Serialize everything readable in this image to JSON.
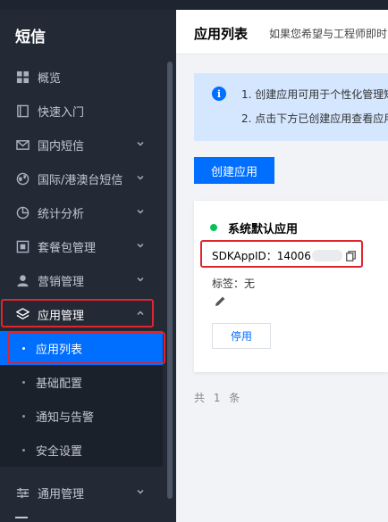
{
  "sidebar": {
    "title": "短信",
    "items": [
      {
        "label": "概览",
        "icon": "grid-icon",
        "chevron": false
      },
      {
        "label": "快速入门",
        "icon": "book-icon",
        "chevron": false
      },
      {
        "label": "国内短信",
        "icon": "mail-icon",
        "chevron": true
      },
      {
        "label": "国际/港澳台短信",
        "icon": "globe-icon",
        "chevron": true
      },
      {
        "label": "统计分析",
        "icon": "pie-chart-icon",
        "chevron": true
      },
      {
        "label": "套餐包管理",
        "icon": "package-icon",
        "chevron": true
      },
      {
        "label": "营销管理",
        "icon": "user-icon",
        "chevron": true
      },
      {
        "label": "应用管理",
        "icon": "layers-icon",
        "chevron": true,
        "expanded": true
      },
      {
        "label": "通用管理",
        "icon": "sliders-icon",
        "chevron": true
      }
    ],
    "subitems": [
      {
        "label": "应用列表",
        "active": true
      },
      {
        "label": "基础配置",
        "active": false
      },
      {
        "label": "通知与告警",
        "active": false
      },
      {
        "label": "安全设置",
        "active": false
      }
    ]
  },
  "header": {
    "title": "应用列表",
    "note": "如果您希望与工程师即时"
  },
  "notice": {
    "line1": "1. 创建应用可用于个性化管理短",
    "line2": "2. 点击下方已创建应用查看应用"
  },
  "create_button": "创建应用",
  "card": {
    "name": "系统默认应用",
    "sdk_label": "SDKAppID：",
    "sdk_visible": "14006",
    "tags_label": "标签：",
    "tags_value": "无",
    "disable_button": "停用"
  },
  "total": "共 1 条",
  "colors": {
    "primary": "#006eff",
    "sidebar_bg": "#232a36",
    "highlight_border": "#e0252f",
    "status_green": "#0abf5b",
    "notice_bg": "#d5e7ff"
  }
}
